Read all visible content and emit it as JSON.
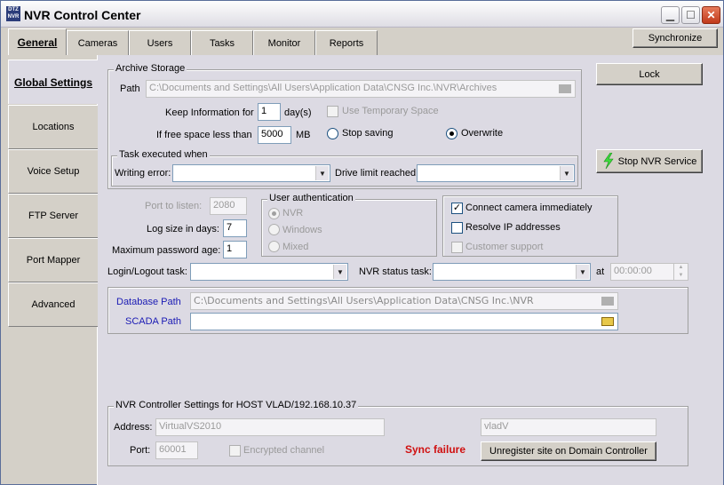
{
  "window": {
    "title": "NVR Control Center",
    "icon_text": "DTZ NVR",
    "min_icon": "minimize-icon",
    "max_icon": "maximize-icon",
    "close_icon": "close-icon"
  },
  "tabs": [
    {
      "label": "General",
      "active": true
    },
    {
      "label": "Cameras"
    },
    {
      "label": "Users"
    },
    {
      "label": "Tasks"
    },
    {
      "label": "Monitor"
    },
    {
      "label": "Reports"
    }
  ],
  "sync_button": "Synchronize",
  "sidebar": [
    {
      "label": "Global Settings",
      "active": true
    },
    {
      "label": "Locations"
    },
    {
      "label": "Voice Setup"
    },
    {
      "label": "FTP Server"
    },
    {
      "label": "Port Mapper"
    },
    {
      "label": "Advanced"
    }
  ],
  "right_buttons": {
    "lock": "Lock",
    "stop_service": "Stop NVR Service"
  },
  "archive": {
    "group_label": "Archive Storage",
    "path_label": "Path",
    "path_value": "C:\\Documents and Settings\\All Users\\Application Data\\CNSG Inc.\\NVR\\Archives",
    "keep_label": "Keep Information for",
    "keep_value": "1",
    "keep_unit": "day(s)",
    "temp_space_label": "Use Temporary Space",
    "free_space_label": "If free space less than",
    "free_space_value": "5000",
    "free_space_unit": "MB",
    "stop_saving_label": "Stop saving",
    "overwrite_label": "Overwrite",
    "selected_action": "Overwrite"
  },
  "task_when": {
    "group_label": "Task executed when",
    "writing_error_label": "Writing error:",
    "writing_error_value": "",
    "drive_limit_label": "Drive limit reached:",
    "drive_limit_value": ""
  },
  "misc": {
    "port_label": "Port to listen:",
    "port_value": "2080",
    "log_label": "Log size in days:",
    "log_value": "7",
    "pwd_label": "Maximum password age:",
    "pwd_value": "1"
  },
  "auth": {
    "group_label": "User authentication",
    "options": [
      "NVR",
      "Windows",
      "Mixed"
    ],
    "selected": "NVR"
  },
  "options": {
    "connect_label": "Connect camera immediately",
    "connect_checked": true,
    "resolve_label": "Resolve IP addresses",
    "resolve_checked": false,
    "support_label": "Customer support",
    "support_checked": false
  },
  "tasks_row": {
    "login_label": "Login/Logout task:",
    "login_value": "",
    "status_label": "NVR status task:",
    "status_value": "",
    "at_label": "at",
    "at_value": "00:00:00"
  },
  "paths": {
    "db_label": "Database Path",
    "db_value": "C:\\Documents and Settings\\All Users\\Application Data\\CNSG Inc.\\NVR",
    "scada_label": "SCADA Path",
    "scada_value": ""
  },
  "controller": {
    "group_label": "NVR Controller Settings for HOST VLAD/192.168.10.37",
    "address_label": "Address:",
    "address_value": "VirtualVS2010",
    "host_value": "vladV",
    "port_label": "Port:",
    "port_value": "60001",
    "encrypted_label": "Encrypted channel",
    "status": "Sync failure",
    "unregister_button": "Unregister site on Domain Controller"
  },
  "colors": {
    "panel": "#dcdae3",
    "link": "#1a1ab4",
    "status_error": "#d01010",
    "bolt": "#3cdc3c"
  }
}
